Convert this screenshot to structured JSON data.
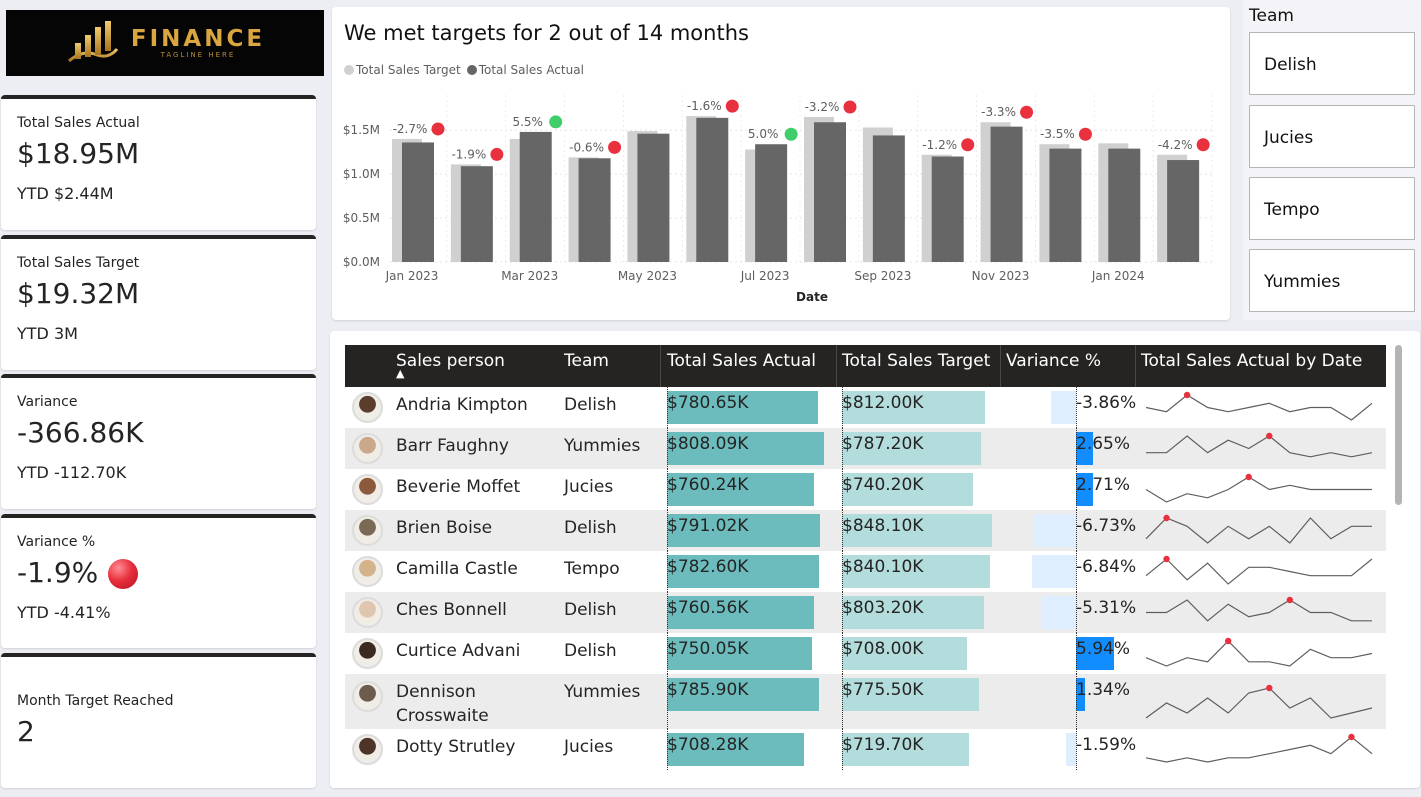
{
  "logo": {
    "name": "FINANCE",
    "tagline": "TAGLINE HERE"
  },
  "kpis": [
    {
      "label": "Total Sales Actual",
      "value": "$18.95M",
      "ytd": "YTD $2.44M"
    },
    {
      "label": "Total Sales Target",
      "value": "$19.32M",
      "ytd": "YTD 3M"
    },
    {
      "label": "Variance",
      "value": "-366.86K",
      "ytd": "YTD -112.70K"
    },
    {
      "label": "Variance %",
      "value": "-1.9%",
      "ytd": "YTD -4.41%"
    },
    {
      "label": "Month Target Reached",
      "value": "2",
      "ytd": ""
    }
  ],
  "chart": {
    "title": "We met targets for 2 out of 14 months",
    "legend_target": "Total Sales Target",
    "legend_actual": "Total Sales Actual",
    "xlabel": "Date"
  },
  "chart_data": {
    "type": "bar",
    "title": "We met targets for 2 out of 14 months",
    "xlabel": "Date",
    "ylabel": "",
    "ylim": [
      0,
      1.9
    ],
    "y_unit": "$M",
    "yticks": [
      "$0.0M",
      "$0.5M",
      "$1.0M",
      "$1.5M"
    ],
    "categories": [
      "Jan 2023",
      "Feb 2023",
      "Mar 2023",
      "Apr 2023",
      "May 2023",
      "Jun 2023",
      "Jul 2023",
      "Aug 2023",
      "Sep 2023",
      "Oct 2023",
      "Nov 2023",
      "Dec 2023",
      "Jan 2024",
      "Feb 2024"
    ],
    "tick_labels": [
      "Jan 2023",
      "",
      "Mar 2023",
      "",
      "May 2023",
      "",
      "Jul 2023",
      "",
      "Sep 2023",
      "",
      "Nov 2023",
      "",
      "Jan 2024",
      ""
    ],
    "series": [
      {
        "name": "Total Sales Target",
        "values": [
          1.4,
          1.11,
          1.4,
          1.19,
          1.49,
          1.66,
          1.28,
          1.65,
          1.53,
          1.22,
          1.59,
          1.34,
          1.35,
          1.22
        ],
        "color": "#d0d0d0"
      },
      {
        "name": "Total Sales Actual",
        "values": [
          1.36,
          1.09,
          1.48,
          1.18,
          1.46,
          1.64,
          1.34,
          1.59,
          1.44,
          1.2,
          1.54,
          1.29,
          1.29,
          1.16
        ],
        "color": "#666666"
      }
    ],
    "variance_labels": [
      "-2.7%",
      "-1.9%",
      "5.5%",
      "-0.6%",
      "",
      "-1.6%",
      "5.0%",
      "-3.2%",
      "",
      "-1.2%",
      "-3.3%",
      "-3.5%",
      "",
      "-4.2%"
    ],
    "variance_status": [
      "miss",
      "miss",
      "hit",
      "miss",
      "",
      "miss",
      "hit",
      "miss",
      "",
      "miss",
      "miss",
      "miss",
      "",
      "miss"
    ],
    "status_colors": {
      "hit": "#3fce6a",
      "miss": "#e8303e"
    }
  },
  "slicer": {
    "title": "Team",
    "items": [
      "Delish",
      "Jucies",
      "Tempo",
      "Yummies"
    ]
  },
  "table": {
    "headers": [
      "Sales person",
      "Team",
      "Total Sales Actual",
      "Total Sales Target",
      "Variance %",
      "Total Sales Actual by Date"
    ],
    "sort_indicator": "▲",
    "rows": [
      {
        "name": "Andria Kimpton",
        "team": "Delish",
        "actual": "$780.65K",
        "actual_k": 780.65,
        "target": "$812.00K",
        "target_k": 812.0,
        "variance": "-3.86%",
        "variance_pct": -3.86,
        "spark": [
          3,
          2,
          6,
          3,
          2,
          3,
          4,
          2,
          3,
          3,
          0,
          4
        ],
        "spark_peak": 2
      },
      {
        "name": "Barr Faughny",
        "team": "Yummies",
        "actual": "$808.09K",
        "actual_k": 808.09,
        "target": "$787.20K",
        "target_k": 787.2,
        "variance": "2.65%",
        "variance_pct": 2.65,
        "spark": [
          2,
          2,
          6,
          2,
          5,
          3,
          6,
          2,
          1,
          2,
          1,
          2
        ],
        "spark_peak": 6
      },
      {
        "name": "Beverie Moffet",
        "team": "Jucies",
        "actual": "$760.24K",
        "actual_k": 760.24,
        "target": "$740.20K",
        "target_k": 740.2,
        "variance": "2.71%",
        "variance_pct": 2.71,
        "spark": [
          3,
          0,
          2,
          1,
          3,
          6,
          3,
          4,
          3,
          3,
          3,
          3
        ],
        "spark_peak": 5
      },
      {
        "name": "Brien Boise",
        "team": "Delish",
        "actual": "$791.02K",
        "actual_k": 791.02,
        "target": "$848.10K",
        "target_k": 848.1,
        "variance": "-6.73%",
        "variance_pct": -6.73,
        "spark": [
          1,
          6,
          4,
          0,
          4,
          1,
          4,
          0,
          6,
          1,
          4,
          4
        ],
        "spark_peak": 1
      },
      {
        "name": "Camilla Castle",
        "team": "Tempo",
        "actual": "$782.60K",
        "actual_k": 782.6,
        "target": "$840.10K",
        "target_k": 840.1,
        "variance": "-6.84%",
        "variance_pct": -6.84,
        "spark": [
          2,
          6,
          1,
          5,
          0,
          4,
          4,
          3,
          2,
          2,
          2,
          6
        ],
        "spark_peak": 1
      },
      {
        "name": "Ches Bonnell",
        "team": "Delish",
        "actual": "$760.56K",
        "actual_k": 760.56,
        "target": "$803.20K",
        "target_k": 803.2,
        "variance": "-5.31%",
        "variance_pct": -5.31,
        "spark": [
          3,
          3,
          6,
          1,
          5,
          2,
          3,
          6,
          3,
          3,
          1,
          1
        ],
        "spark_peak": 7
      },
      {
        "name": "Curtice Advani",
        "team": "Delish",
        "actual": "$750.05K",
        "actual_k": 750.05,
        "target": "$708.00K",
        "target_k": 708.0,
        "variance": "5.94%",
        "variance_pct": 5.94,
        "spark": [
          2,
          0,
          2,
          1,
          6,
          1,
          1,
          0,
          4,
          2,
          2,
          3
        ],
        "spark_peak": 4
      },
      {
        "name": "Dennison Crosswaite",
        "team": "Yummies",
        "actual": "$785.90K",
        "actual_k": 785.9,
        "target": "$775.50K",
        "target_k": 775.5,
        "variance": "1.34%",
        "variance_pct": 1.34,
        "spark": [
          0,
          3,
          1,
          4,
          1,
          5,
          6,
          2,
          4,
          0,
          1,
          2
        ],
        "spark_peak": 6
      },
      {
        "name": "Dotty Strutley",
        "team": "Jucies",
        "actual": "$708.28K",
        "actual_k": 708.28,
        "target": "$719.70K",
        "target_k": 719.7,
        "variance": "-1.59%",
        "variance_pct": -1.59,
        "spark": [
          1,
          0,
          1,
          0,
          1,
          1,
          2,
          3,
          4,
          2,
          6,
          2
        ],
        "spark_peak": 10
      }
    ]
  },
  "colors": {
    "bar_actual": "#6cbcbe",
    "bar_target": "#b3dcdd",
    "variance_positive": "#118dff",
    "variance_negative": "#deeefe",
    "spark_line": "#605e5c",
    "spark_marker": "#e8303e"
  }
}
